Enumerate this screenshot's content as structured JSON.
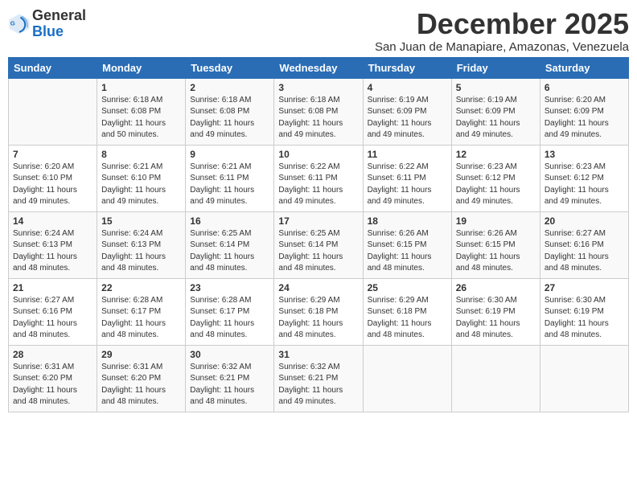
{
  "header": {
    "logo_general": "General",
    "logo_blue": "Blue",
    "month_title": "December 2025",
    "subtitle": "San Juan de Manapiare, Amazonas, Venezuela"
  },
  "calendar": {
    "days_of_week": [
      "Sunday",
      "Monday",
      "Tuesday",
      "Wednesday",
      "Thursday",
      "Friday",
      "Saturday"
    ],
    "weeks": [
      [
        {
          "day": "",
          "info": ""
        },
        {
          "day": "1",
          "info": "Sunrise: 6:18 AM\nSunset: 6:08 PM\nDaylight: 11 hours\nand 50 minutes."
        },
        {
          "day": "2",
          "info": "Sunrise: 6:18 AM\nSunset: 6:08 PM\nDaylight: 11 hours\nand 49 minutes."
        },
        {
          "day": "3",
          "info": "Sunrise: 6:18 AM\nSunset: 6:08 PM\nDaylight: 11 hours\nand 49 minutes."
        },
        {
          "day": "4",
          "info": "Sunrise: 6:19 AM\nSunset: 6:09 PM\nDaylight: 11 hours\nand 49 minutes."
        },
        {
          "day": "5",
          "info": "Sunrise: 6:19 AM\nSunset: 6:09 PM\nDaylight: 11 hours\nand 49 minutes."
        },
        {
          "day": "6",
          "info": "Sunrise: 6:20 AM\nSunset: 6:09 PM\nDaylight: 11 hours\nand 49 minutes."
        }
      ],
      [
        {
          "day": "7",
          "info": "Sunrise: 6:20 AM\nSunset: 6:10 PM\nDaylight: 11 hours\nand 49 minutes."
        },
        {
          "day": "8",
          "info": "Sunrise: 6:21 AM\nSunset: 6:10 PM\nDaylight: 11 hours\nand 49 minutes."
        },
        {
          "day": "9",
          "info": "Sunrise: 6:21 AM\nSunset: 6:11 PM\nDaylight: 11 hours\nand 49 minutes."
        },
        {
          "day": "10",
          "info": "Sunrise: 6:22 AM\nSunset: 6:11 PM\nDaylight: 11 hours\nand 49 minutes."
        },
        {
          "day": "11",
          "info": "Sunrise: 6:22 AM\nSunset: 6:11 PM\nDaylight: 11 hours\nand 49 minutes."
        },
        {
          "day": "12",
          "info": "Sunrise: 6:23 AM\nSunset: 6:12 PM\nDaylight: 11 hours\nand 49 minutes."
        },
        {
          "day": "13",
          "info": "Sunrise: 6:23 AM\nSunset: 6:12 PM\nDaylight: 11 hours\nand 49 minutes."
        }
      ],
      [
        {
          "day": "14",
          "info": "Sunrise: 6:24 AM\nSunset: 6:13 PM\nDaylight: 11 hours\nand 48 minutes."
        },
        {
          "day": "15",
          "info": "Sunrise: 6:24 AM\nSunset: 6:13 PM\nDaylight: 11 hours\nand 48 minutes."
        },
        {
          "day": "16",
          "info": "Sunrise: 6:25 AM\nSunset: 6:14 PM\nDaylight: 11 hours\nand 48 minutes."
        },
        {
          "day": "17",
          "info": "Sunrise: 6:25 AM\nSunset: 6:14 PM\nDaylight: 11 hours\nand 48 minutes."
        },
        {
          "day": "18",
          "info": "Sunrise: 6:26 AM\nSunset: 6:15 PM\nDaylight: 11 hours\nand 48 minutes."
        },
        {
          "day": "19",
          "info": "Sunrise: 6:26 AM\nSunset: 6:15 PM\nDaylight: 11 hours\nand 48 minutes."
        },
        {
          "day": "20",
          "info": "Sunrise: 6:27 AM\nSunset: 6:16 PM\nDaylight: 11 hours\nand 48 minutes."
        }
      ],
      [
        {
          "day": "21",
          "info": "Sunrise: 6:27 AM\nSunset: 6:16 PM\nDaylight: 11 hours\nand 48 minutes."
        },
        {
          "day": "22",
          "info": "Sunrise: 6:28 AM\nSunset: 6:17 PM\nDaylight: 11 hours\nand 48 minutes."
        },
        {
          "day": "23",
          "info": "Sunrise: 6:28 AM\nSunset: 6:17 PM\nDaylight: 11 hours\nand 48 minutes."
        },
        {
          "day": "24",
          "info": "Sunrise: 6:29 AM\nSunset: 6:18 PM\nDaylight: 11 hours\nand 48 minutes."
        },
        {
          "day": "25",
          "info": "Sunrise: 6:29 AM\nSunset: 6:18 PM\nDaylight: 11 hours\nand 48 minutes."
        },
        {
          "day": "26",
          "info": "Sunrise: 6:30 AM\nSunset: 6:19 PM\nDaylight: 11 hours\nand 48 minutes."
        },
        {
          "day": "27",
          "info": "Sunrise: 6:30 AM\nSunset: 6:19 PM\nDaylight: 11 hours\nand 48 minutes."
        }
      ],
      [
        {
          "day": "28",
          "info": "Sunrise: 6:31 AM\nSunset: 6:20 PM\nDaylight: 11 hours\nand 48 minutes."
        },
        {
          "day": "29",
          "info": "Sunrise: 6:31 AM\nSunset: 6:20 PM\nDaylight: 11 hours\nand 48 minutes."
        },
        {
          "day": "30",
          "info": "Sunrise: 6:32 AM\nSunset: 6:21 PM\nDaylight: 11 hours\nand 48 minutes."
        },
        {
          "day": "31",
          "info": "Sunrise: 6:32 AM\nSunset: 6:21 PM\nDaylight: 11 hours\nand 49 minutes."
        },
        {
          "day": "",
          "info": ""
        },
        {
          "day": "",
          "info": ""
        },
        {
          "day": "",
          "info": ""
        }
      ]
    ]
  }
}
